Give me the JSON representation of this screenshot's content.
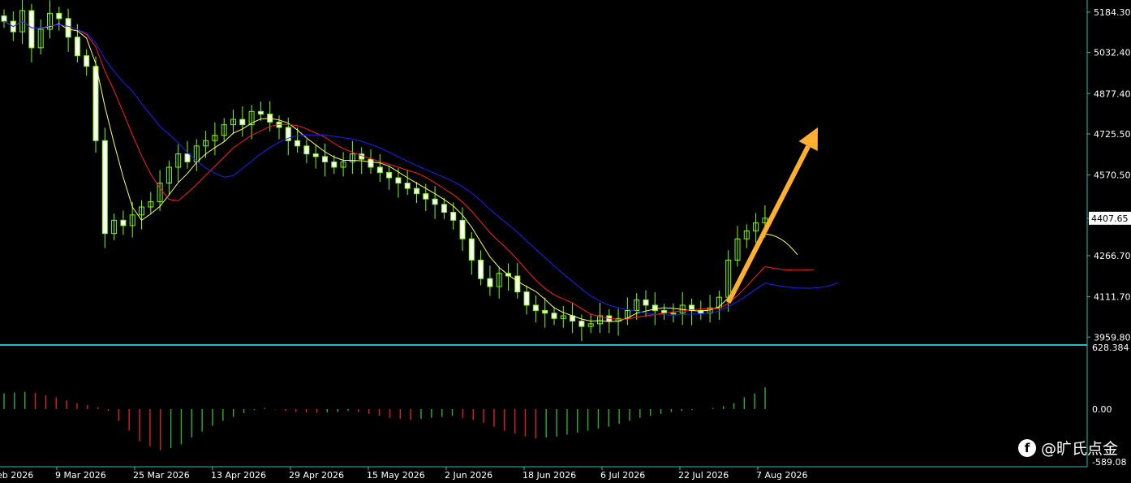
{
  "price_axis": {
    "labels": [
      "5184.30",
      "5032.40",
      "4877.40",
      "4725.50",
      "4570.50",
      "4407.65",
      "4266.70",
      "4111.70",
      "3959.80"
    ],
    "current_price": "4407.65"
  },
  "osc_axis": {
    "labels": [
      "628.384",
      "0.00",
      "-589.08"
    ]
  },
  "date_axis": {
    "labels": [
      "eb 2026",
      "9 Mar 2026",
      "25 Mar 2026",
      "13 Apr 2026",
      "29 Apr 2026",
      "15 May 2026",
      "2 Jun 2026",
      "18 Jun 2026",
      "6 Jul 2026",
      "22 Jul 2026",
      "7 Aug 2026"
    ]
  },
  "watermark": "@旷氏点金",
  "colors": {
    "background": "#000000",
    "up_candle": "#7cfc00",
    "down_candle": "#ffffff",
    "ma_fast": "#ffff66",
    "ma_mid": "#ff2020",
    "ma_slow": "#2020ff",
    "axis": "#20c0c0",
    "text": "#ffffff",
    "arrow": "#ffb030",
    "osc_up": "#30b030",
    "osc_down": "#e02020"
  },
  "chart_data": [
    {
      "type": "candlestick",
      "title": "",
      "ylim": [
        3930,
        5230
      ],
      "indicators": [
        "MA fast (yellow)",
        "MA mid (red)",
        "MA slow (blue)"
      ],
      "annotations": [
        {
          "type": "arrow",
          "direction": "up",
          "from_price": 4090,
          "to_price": 4750
        }
      ],
      "closes": [
        5150,
        5110,
        5190,
        5050,
        5120,
        5180,
        5160,
        5090,
        5020,
        4980,
        4700,
        4350,
        4400,
        4380,
        4420,
        4450,
        4470,
        4540,
        4600,
        4650,
        4620,
        4680,
        4700,
        4720,
        4760,
        4780,
        4760,
        4810,
        4800,
        4770,
        4750,
        4700,
        4680,
        4650,
        4640,
        4620,
        4600,
        4620,
        4650,
        4630,
        4600,
        4580,
        4560,
        4540,
        4520,
        4500,
        4480,
        4460,
        4430,
        4400,
        4330,
        4250,
        4180,
        4150,
        4200,
        4190,
        4130,
        4080,
        4060,
        4050,
        4030,
        4040,
        4020,
        4000,
        4010,
        4040,
        4020,
        4030,
        4060,
        4100,
        4080,
        4060,
        4050,
        4050,
        4080,
        4060,
        4050,
        4070,
        4110,
        4250,
        4330,
        4360,
        4390,
        4407.65
      ],
      "ma_fast_end": 4407.65
    },
    {
      "type": "histogram",
      "title": "",
      "ylim": [
        -589.08,
        628.384
      ],
      "values": [
        160,
        170,
        175,
        165,
        140,
        120,
        90,
        60,
        40,
        20,
        -20,
        -120,
        -220,
        -330,
        -380,
        -420,
        -400,
        -360,
        -290,
        -230,
        -170,
        -120,
        -80,
        -40,
        -10,
        10,
        -5,
        -20,
        -30,
        -35,
        -40,
        -35,
        -30,
        -20,
        -30,
        -50,
        -70,
        -90,
        -100,
        -110,
        -100,
        -90,
        -80,
        -70,
        -90,
        -110,
        -140,
        -180,
        -220,
        -250,
        -280,
        -300,
        -290,
        -280,
        -260,
        -240,
        -220,
        -200,
        -180,
        -150,
        -120,
        -90,
        -70,
        -50,
        -30,
        -20,
        -10,
        0,
        10,
        30,
        60,
        120,
        160,
        220
      ]
    }
  ]
}
